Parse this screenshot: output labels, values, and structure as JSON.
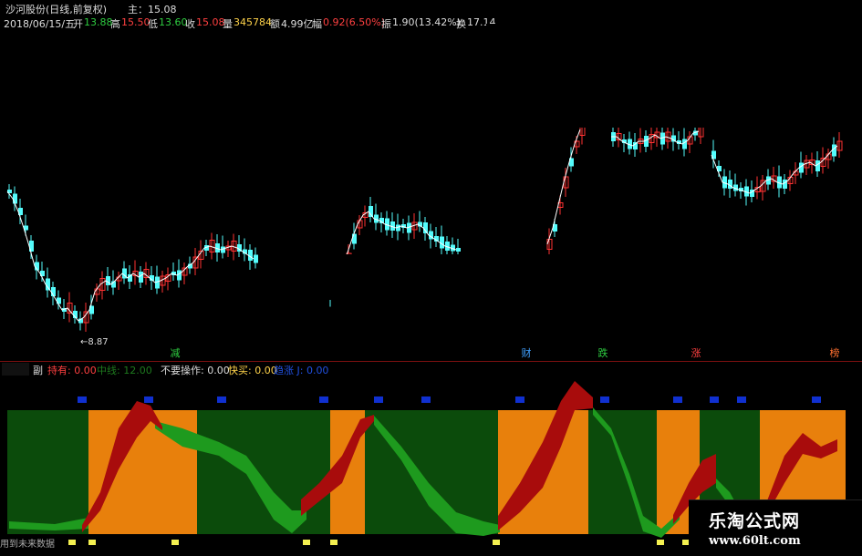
{
  "stock": {
    "name": "沙河股份(日线,前复权)",
    "main_label": "主：15.08"
  },
  "info_bar": {
    "date": "2018/06/15/五",
    "open_label": "开",
    "open": "13.88",
    "high_label": "高",
    "high": "15.50",
    "low_label": "低",
    "low": "13.60",
    "close_label": "收",
    "close": "15.08",
    "vol_label": "量",
    "vol": "345784",
    "amount_label": "额",
    "amount": "4.99亿",
    "change_label": "幅",
    "change": "0.92(6.50%)",
    "amplitude_label": "振",
    "amplitude": "1.90(13.42%)",
    "turnover_label": "换",
    "turnover": "17.14"
  },
  "chart_labels": {
    "low_marker": "8.87",
    "signals": [
      {
        "text": "减",
        "color": "#2ecc40"
      },
      {
        "text": "财",
        "color": "#3fa0ff"
      },
      {
        "text": "跌",
        "color": "#2ecc40"
      },
      {
        "text": "涨",
        "color": "#ff4040"
      },
      {
        "text": "榜",
        "color": "#ff7030"
      }
    ]
  },
  "indicator_bar": {
    "name": "副",
    "hold_label": "持有: 0.00",
    "mid_label": "中线: 12.00",
    "no_op_label": "不要操作: 0.00",
    "fast_buy_label": "快买: 0.00",
    "trend_label": "趋涨 J: 0.00"
  },
  "footnote": "用到未来数据",
  "watermark": {
    "title": "乐淘公式网",
    "url": "www.60lt.com"
  },
  "colors": {
    "up": "#ff3232",
    "down": "#54fcfc",
    "ma": "#ffffff",
    "orange_zone": "#e8800c",
    "green_zone": "#0b4b0b",
    "red_ribbon": "#a80c0c",
    "green_ribbon": "#1e9a1e",
    "blue_marker": "#1030d0",
    "yellow_marker": "#f4f050"
  }
}
